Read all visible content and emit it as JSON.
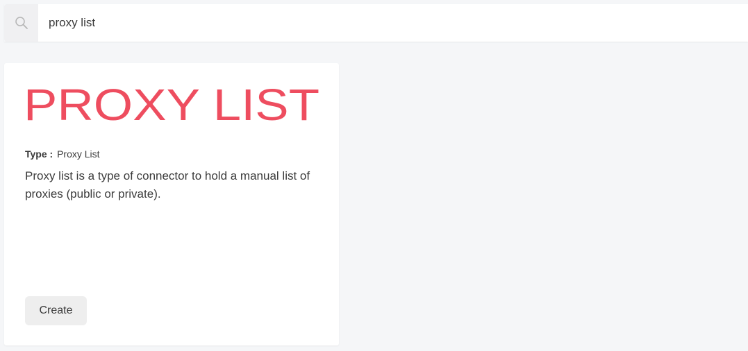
{
  "search": {
    "value": "proxy list",
    "icon": "search-icon"
  },
  "card": {
    "logo_text": "PROXY LIST",
    "logo_color": "#ee4d5f",
    "type_label": "Type :",
    "type_value": "Proxy List",
    "description": "Proxy list is a type of connector to hold a manual list of proxies (public or private).",
    "create_label": "Create"
  }
}
